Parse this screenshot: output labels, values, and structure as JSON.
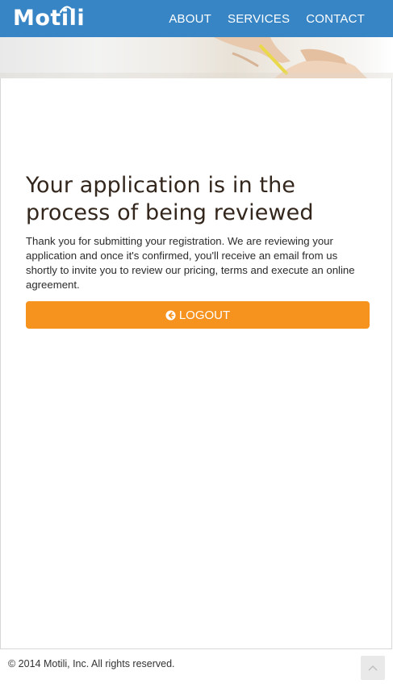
{
  "brand": {
    "logo_text": "Motili",
    "primary_color": "#3785c4",
    "accent_color": "#f6921e"
  },
  "nav": {
    "items": [
      "ABOUT",
      "SERVICES",
      "CONTACT"
    ]
  },
  "main": {
    "title": "Your application is in the process of being reviewed",
    "message": "Thank you for submitting your registration. We are reviewing your application and once it's confirmed, you'll receive an email from us shortly to invite you to review our pricing, terms and execute an online agreement.",
    "logout_button": {
      "label": "LOGOUT",
      "icon": "arrow-circle-left-icon"
    }
  },
  "footer": {
    "copyright": "© 2014 Motili, Inc. All rights reserved.",
    "scroll_top_icon": "chevron-up-icon"
  }
}
